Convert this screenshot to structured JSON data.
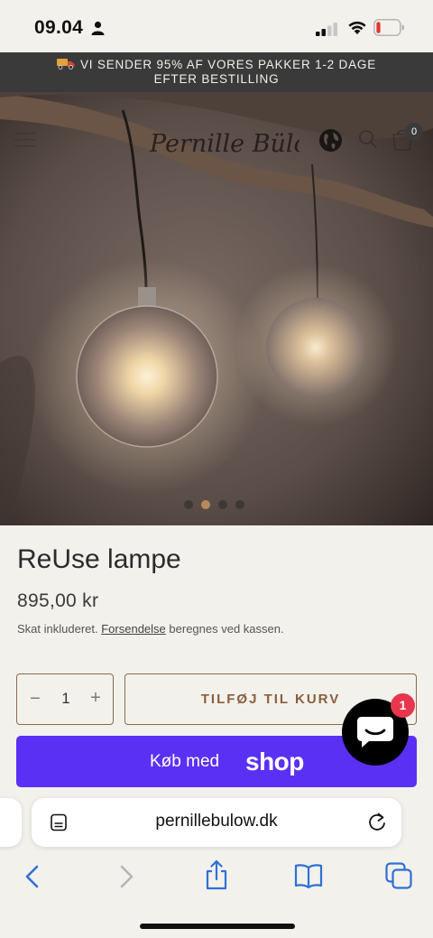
{
  "status_bar": {
    "time": "09.04",
    "icons": [
      "person-icon",
      "signal-icon",
      "wifi-icon",
      "battery-icon"
    ]
  },
  "announcement": {
    "icon": "truck-icon",
    "line1": "VI SENDER 95% AF VORES PAKKER 1-2 DAGE",
    "line2": "EFTER BESTILLING"
  },
  "header": {
    "logo_text": "Pernille Bülow",
    "cart_count": "0",
    "icons": [
      "menu-icon",
      "globe-icon",
      "search-icon",
      "cart-icon"
    ]
  },
  "gallery": {
    "slides": 4,
    "active_slide": 2
  },
  "product": {
    "title": "ReUse lampe",
    "price": "895,00 kr",
    "tax_prefix": "Skat inkluderet.",
    "shipping_link": "Forsendelse",
    "tax_suffix": "beregnes ved kassen."
  },
  "purchase": {
    "qty_minus": "−",
    "quantity": "1",
    "qty_plus": "+",
    "add_to_cart": "TILFØJ TIL KURV",
    "shop_pay_label": "Køb med",
    "shop_pay_brand": "shop"
  },
  "chat": {
    "badge": "1"
  },
  "browser": {
    "url": "pernillebulow.dk",
    "icons": [
      "reader-icon",
      "reload-icon",
      "back-icon",
      "forward-icon",
      "share-icon",
      "bookmarks-icon",
      "tabs-icon"
    ]
  },
  "colors": {
    "background": "#f3f1ec",
    "announcement_bg": "#3a3a3a",
    "accent_brown": "#8a5f3c",
    "shop_pay": "#5a31f4",
    "chat_badge": "#e8374c"
  }
}
